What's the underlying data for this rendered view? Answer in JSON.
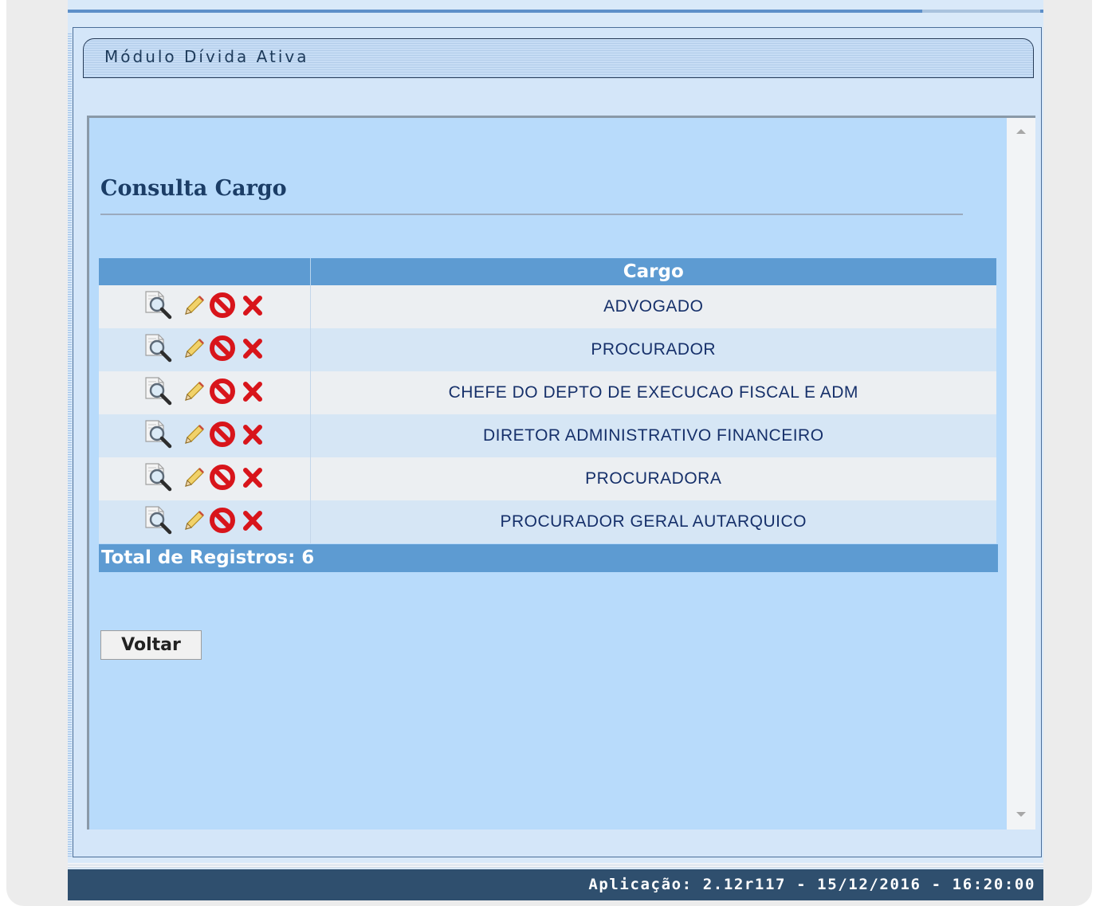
{
  "module": {
    "title": "Módulo Dívida Ativa"
  },
  "page": {
    "title": "Consulta Cargo"
  },
  "table": {
    "columns": [
      "",
      "Cargo"
    ],
    "rows": [
      {
        "cargo": "ADVOGADO"
      },
      {
        "cargo": "PROCURADOR"
      },
      {
        "cargo": "CHEFE DO DEPTO DE EXECUCAO FISCAL E ADM"
      },
      {
        "cargo": "DIRETOR ADMINISTRATIVO FINANCEIRO"
      },
      {
        "cargo": "PROCURADORA"
      },
      {
        "cargo": "PROCURADOR GERAL AUTARQUICO"
      }
    ],
    "row_actions": [
      "view-icon",
      "edit-pencil-icon",
      "disable-icon",
      "delete-icon"
    ],
    "total_label": "Total de Registros: 6"
  },
  "buttons": {
    "voltar": "Voltar"
  },
  "footer": {
    "text": "Aplicação: 2.12r117 - 15/12/2016 - 16:20:00"
  },
  "colors": {
    "header": "#5d9bd2",
    "panel": "#b8dbfb",
    "footer": "#2f4f6e",
    "row_odd": "#eceff2",
    "row_even": "#d6e6f5"
  }
}
